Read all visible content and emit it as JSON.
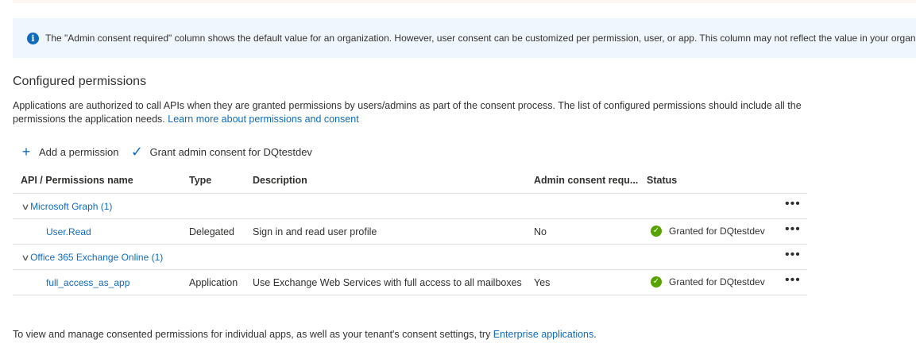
{
  "info": {
    "icon": "info-icon",
    "text": "The \"Admin consent required\" column shows the default value for an organization. However, user consent can be customized per permission, user, or app. This column may not reflect the value in your organization"
  },
  "section": {
    "title": "Configured permissions",
    "description": "Applications are authorized to call APIs when they are granted permissions by users/admins as part of the consent process. The list of configured permissions should include all the permissions the application needs.",
    "link": "Learn more about permissions and consent"
  },
  "toolbar": {
    "add_label": "Add a permission",
    "grant_label": "Grant admin consent for DQtestdev"
  },
  "table": {
    "headers": {
      "name": "API / Permissions name",
      "type": "Type",
      "description": "Description",
      "admin": "Admin consent requ...",
      "status": "Status"
    },
    "groups": [
      {
        "name": "Microsoft Graph (1)",
        "permissions": [
          {
            "name": "User.Read",
            "type": "Delegated",
            "description": "Sign in and read user profile",
            "admin": "No",
            "status": "Granted for DQtestdev"
          }
        ]
      },
      {
        "name": "Office 365 Exchange Online (1)",
        "permissions": [
          {
            "name": "full_access_as_app",
            "type": "Application",
            "description": "Use Exchange Web Services with full access to all mailboxes",
            "admin": "Yes",
            "status": "Granted for DQtestdev"
          }
        ]
      }
    ],
    "more_label": "•••"
  },
  "footer": {
    "text": "To view and manage consented permissions for individual apps, as well as your tenant's consent settings, try ",
    "link": "Enterprise applications",
    "end": "."
  },
  "colors": {
    "accent": "#0f6cbd",
    "success": "#57a300",
    "info_bg": "#f0f6fd"
  }
}
